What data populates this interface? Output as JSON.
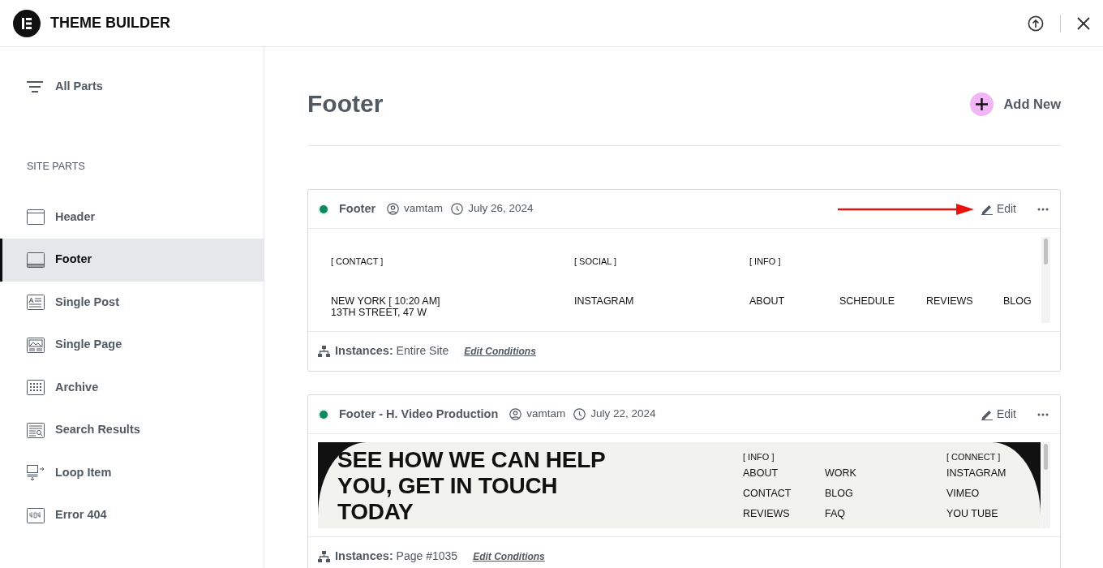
{
  "app": {
    "title": "THEME BUILDER"
  },
  "sidebar": {
    "all_parts": "All Parts",
    "section_title": "SITE PARTS",
    "items": [
      {
        "label": "Header",
        "selected": false
      },
      {
        "label": "Footer",
        "selected": true
      },
      {
        "label": "Single Post",
        "selected": false
      },
      {
        "label": "Single Page",
        "selected": false
      },
      {
        "label": "Archive",
        "selected": false
      },
      {
        "label": "Search Results",
        "selected": false
      },
      {
        "label": "Loop Item",
        "selected": false
      },
      {
        "label": "Error 404",
        "selected": false
      }
    ]
  },
  "main": {
    "title": "Footer",
    "add_button": "Add New"
  },
  "cards": [
    {
      "title": "Footer",
      "active": true,
      "author": "vamtam",
      "date": "July 26, 2024",
      "edit": "Edit",
      "pointer_arrow": true,
      "instances": "**Instances:** Entire Site",
      "edit_conditions": "Edit Conditions",
      "preview": {
        "kind": "plain",
        "columns": [
          {
            "heading": "[ CONTACT ]",
            "items": [
              "NEW YORK [ 10:20 AM]",
              "13TH STREET, 47 W"
            ]
          },
          {
            "heading": "[ SOCIAL ]",
            "items": [
              "INSTAGRAM"
            ]
          },
          {
            "heading": "[ INFO ]",
            "items": [
              "ABOUT"
            ]
          },
          {
            "items": [
              "SCHEDULE"
            ]
          },
          {
            "items": [
              "REVIEWS"
            ]
          },
          {
            "items": [
              "BLOG"
            ]
          }
        ]
      }
    },
    {
      "title": "Footer - H. Video Production",
      "active": true,
      "author": "vamtam",
      "date": "July 22, 2024",
      "edit": "Edit",
      "pointer_arrow": false,
      "instances": "**Instances:** Page #1035",
      "edit_conditions": "Edit Conditions",
      "preview": {
        "kind": "banner",
        "headline": "SEE HOW WE CAN HELP YOU, GET IN TOUCH TODAY",
        "columns": [
          {
            "heading": "[ INFO ]",
            "items": [
              "ABOUT",
              "CONTACT",
              "REVIEWS"
            ]
          },
          {
            "items": [
              "WORK",
              "BLOG",
              "FAQ"
            ]
          },
          {
            "heading": "[ CONNECT ]",
            "items": [
              "INSTAGRAM",
              "VIMEO",
              "YOU TUBE"
            ]
          }
        ]
      }
    }
  ]
}
